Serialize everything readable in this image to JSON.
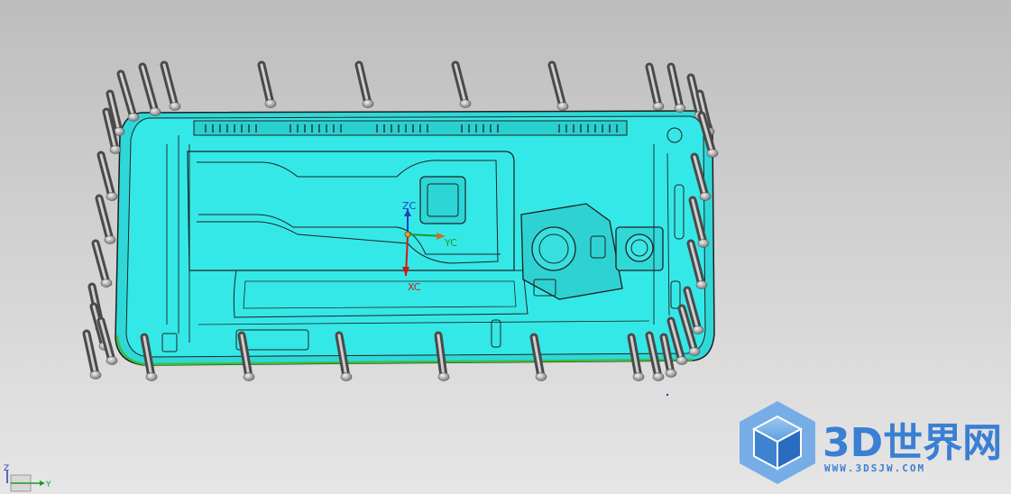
{
  "viewport": {
    "background_top": "#bdbdbd",
    "background_bottom": "#e6e6e6",
    "part_color": "#32e6e6",
    "part_edge_color": "#1a1a1a",
    "pin_color": "#888888"
  },
  "wcs": {
    "zc_label": "ZC",
    "yc_label": "YC",
    "xc_label": "XC",
    "zc_color": "#1f3fbf",
    "yc_color": "#1a9a2a",
    "xc_color": "#d01818"
  },
  "view_triad": {
    "z_label": "Z",
    "y_label": "Y"
  },
  "watermark": {
    "title": "3D世界网",
    "url": "WWW.3DSJW.COM",
    "color": "#3a7fd4",
    "logo_icon": "cube-logo-icon"
  }
}
